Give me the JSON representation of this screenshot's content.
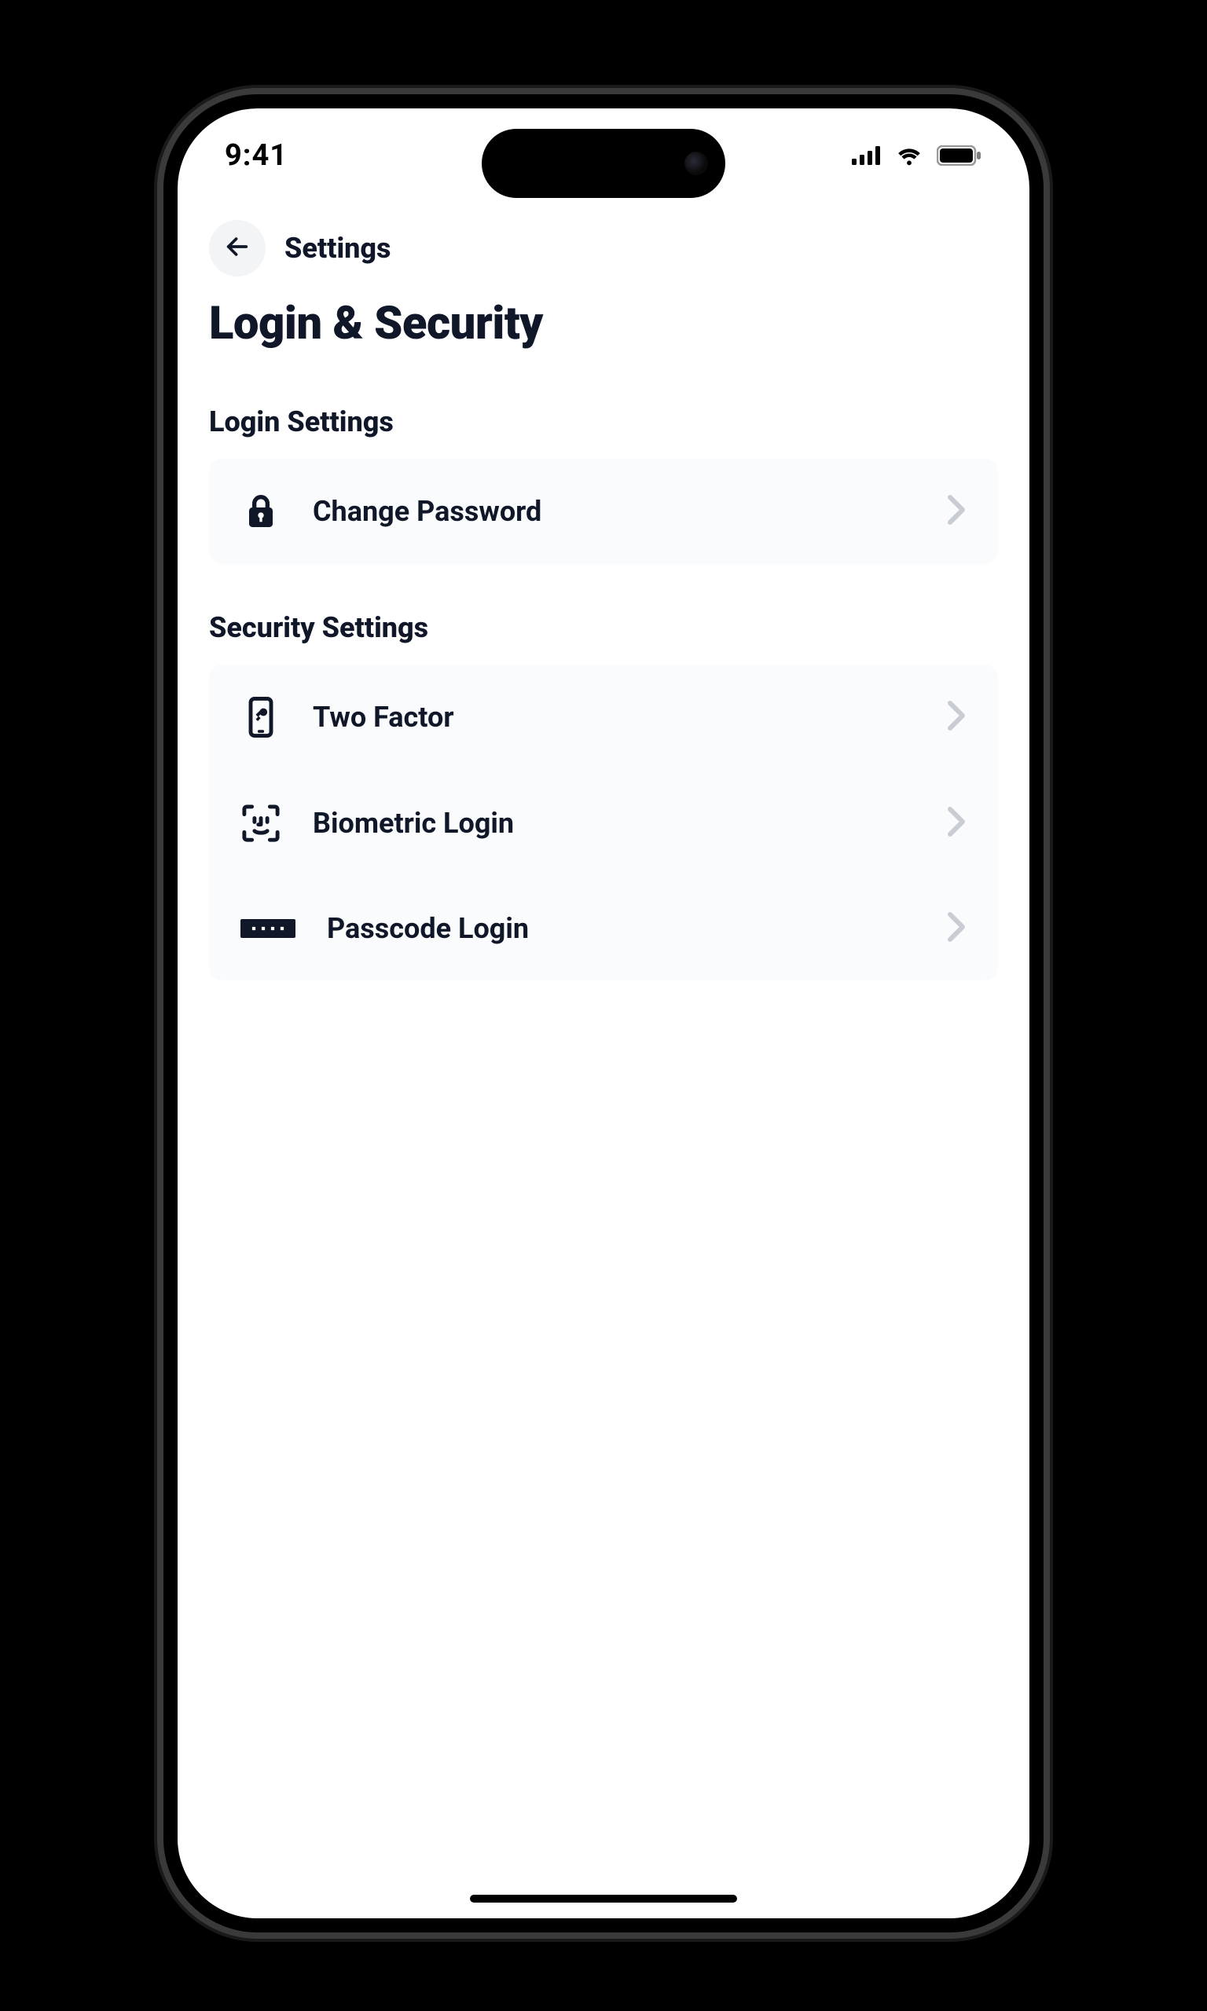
{
  "status": {
    "time": "9:41"
  },
  "nav": {
    "back_label": "Settings"
  },
  "page": {
    "title": "Login & Security"
  },
  "sections": [
    {
      "title": "Login Settings",
      "items": [
        {
          "icon": "lock-icon",
          "label": "Change Password"
        }
      ]
    },
    {
      "title": "Security Settings",
      "items": [
        {
          "icon": "phone-key-icon",
          "label": "Two Factor"
        },
        {
          "icon": "face-scan-icon",
          "label": "Biometric Login"
        },
        {
          "icon": "passcode-icon",
          "label": "Passcode Login"
        }
      ]
    }
  ]
}
